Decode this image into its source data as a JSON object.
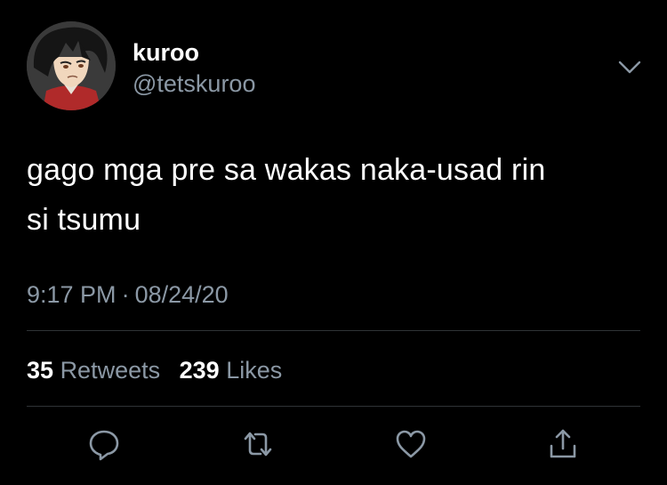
{
  "user": {
    "display_name": "kuroo",
    "handle": "@tetskuroo"
  },
  "tweet": {
    "text_line1": "gago mga pre sa wakas naka-usad rin",
    "text_line2": "si tsumu",
    "time": "9:17 PM",
    "separator": "·",
    "date": "08/24/20"
  },
  "stats": {
    "retweets_count": "35",
    "retweets_label": "Retweets",
    "likes_count": "239",
    "likes_label": "Likes"
  },
  "icons": {
    "menu": "chevron-down-icon",
    "reply": "reply-icon",
    "retweet": "retweet-icon",
    "like": "heart-icon",
    "share": "share-icon"
  },
  "colors": {
    "background": "#000000",
    "text": "#ffffff",
    "secondary_text": "#8b98a5",
    "icon": "#8b98a5"
  }
}
